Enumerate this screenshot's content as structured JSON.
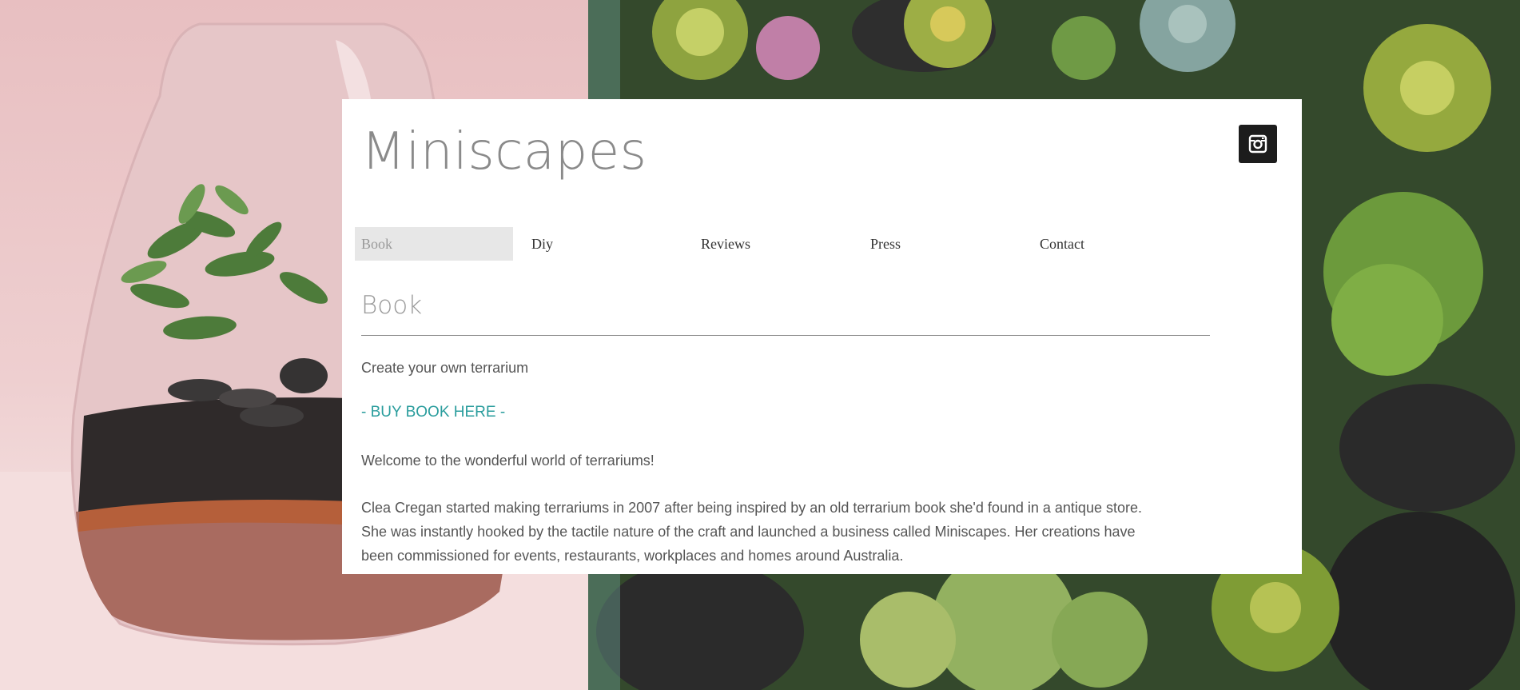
{
  "site": {
    "title": "Miniscapes"
  },
  "social": {
    "instagram_icon": "instagram-icon"
  },
  "nav": {
    "items": [
      {
        "label": "Book",
        "active": true
      },
      {
        "label": "Diy",
        "active": false
      },
      {
        "label": "Reviews",
        "active": false
      },
      {
        "label": "Press",
        "active": false
      },
      {
        "label": "Contact",
        "active": false
      }
    ]
  },
  "page": {
    "heading": "Book",
    "subtitle": "Create your own terrarium",
    "buy_link": "- BUY BOOK HERE -",
    "welcome": "Welcome to the wonderful world of terrariums!",
    "body": "Clea Cregan started making terrariums in 2007 after being inspired by an old terrarium book she'd found in a antique store. She was instantly hooked by the tactile nature of the craft and launched a business called Miniscapes. Her creations have been commissioned for events, restaurants, workplaces and homes around Australia."
  },
  "colors": {
    "accent_link": "#2a9d9d",
    "nav_active_bg": "#e7e7e7",
    "bg_pink": "#eecfd0",
    "bg_green": "#3b5232"
  }
}
